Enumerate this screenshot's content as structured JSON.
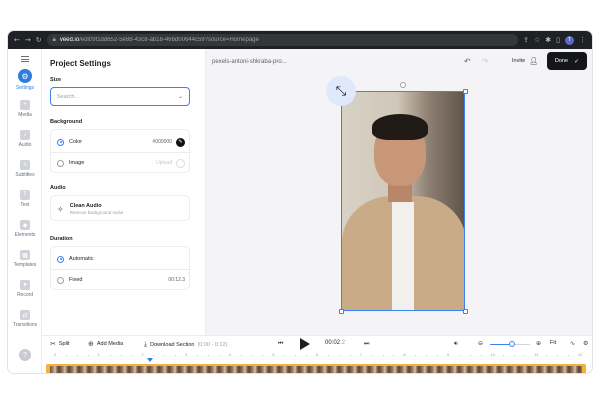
{
  "browser": {
    "url_domain": "veed.io",
    "url_path": "/edit/9f1dd652-5e88-43c8-ab18-46bd00644c59?source=Homepage",
    "avatar_letter": "T"
  },
  "rail": {
    "items": [
      {
        "label": "Settings",
        "active": true
      },
      {
        "label": "Media"
      },
      {
        "label": "Audio"
      },
      {
        "label": "Subtitles"
      },
      {
        "label": "Text"
      },
      {
        "label": "Elements"
      },
      {
        "label": "Templates"
      },
      {
        "label": "Record"
      },
      {
        "label": "Transitions"
      }
    ],
    "help_label": "?"
  },
  "panel": {
    "title": "Project Settings",
    "size_label": "Size",
    "size_placeholder": "Search...",
    "background_label": "Background",
    "color_option": "Color",
    "color_value": "#000000",
    "image_option": "Image",
    "image_value": "Upload",
    "audio_label": "Audio",
    "clean_audio_title": "Clean Audio",
    "clean_audio_sub": "Remove background noise",
    "duration_label": "Duration",
    "automatic_option": "Automatic",
    "fixed_option": "Fixed",
    "fixed_value": "00:12.3"
  },
  "topbar": {
    "filename": "pexels-antoni-shkraba-pro...",
    "invite_label": "Invite",
    "done_label": "Done"
  },
  "timeline": {
    "split_label": "Split",
    "add_media_label": "Add Media",
    "download_label": "Download Section",
    "download_range": "(0:00 - 0:12)",
    "timecode": "00:02",
    "timecode_ms": ":2",
    "fit_label": "Fit",
    "zoom_level": 0.55,
    "ruler_ticks": [
      "0",
      "1",
      "2",
      "3",
      "4",
      "5",
      "6",
      "7",
      "8",
      "9",
      "10",
      "11",
      "12"
    ]
  },
  "colors": {
    "accent": "#2f7de1",
    "done_button": "#15161a",
    "track": "#f3b338"
  }
}
